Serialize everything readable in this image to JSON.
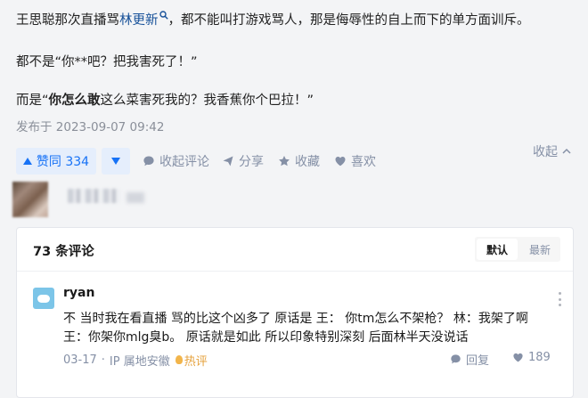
{
  "answer": {
    "p1_pre": "王思聪那次直播骂",
    "p1_link": "林更新",
    "p1_post": "，都不能叫打游戏骂人，那是侮辱性的自上而下的单方面训斥。",
    "p2": "都不是“你**吧？把我害死了！”",
    "p3_pre": "而是“",
    "p3_bold": "你怎么敢",
    "p3_post": "这么菜害死我的？我香蕉你个巴拉！”",
    "published": "发布于 2023-09-07 09:42"
  },
  "actions": {
    "upvote": "赞同 334",
    "collapse_comments": "收起评论",
    "share": "分享",
    "favorite": "收藏",
    "like": "喜欢",
    "collapse": "收起"
  },
  "comments": {
    "count": "73 条评论",
    "sort_default": "默认",
    "sort_latest": "最新",
    "items": [
      {
        "author": "ryan",
        "line1": "不 当时我在看直播 骂的比这个凶多了 原话是 王： 你tm怎么不架枪？ 林：我架了啊",
        "line2": "王：你架你mlg臭b。 原话就是如此 所以印象特别深刻 后面林半天没说话",
        "date": "03-17",
        "location": "IP 属地安徽",
        "hot": "热评",
        "reply": "回复",
        "likes": "189"
      }
    ]
  },
  "colors": {
    "accent": "#1772f6",
    "link": "#175199",
    "muted": "#8590a6",
    "hot": "#e6a23c"
  },
  "icons": [
    "search-icon",
    "upvote-icon",
    "downvote-icon",
    "comment-icon",
    "share-icon",
    "star-icon",
    "heart-icon",
    "chevron-up-icon",
    "more-icon",
    "reply-icon",
    "like-icon",
    "fire-icon"
  ]
}
